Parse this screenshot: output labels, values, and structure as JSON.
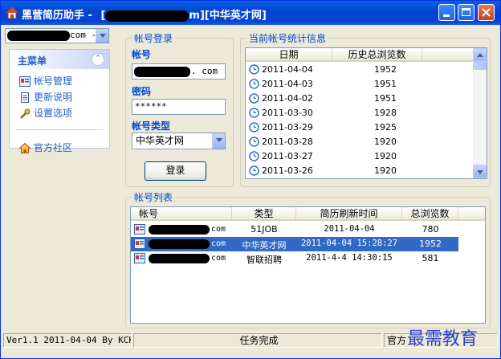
{
  "window": {
    "app_name": "黑营简历助手 -",
    "title_bracket_open": "[",
    "title_mask_suffix": "m]",
    "title_site": "[中华英才网]"
  },
  "left": {
    "account_combo_suffix": "com -",
    "menu_title": "主菜单",
    "collapse_glyph": "⌃",
    "items": [
      "帐号管理",
      "更新说明",
      "设置选项"
    ],
    "community": "官方社区"
  },
  "login": {
    "group_title": "帐号登录",
    "account_label": "帐号",
    "account_value_suffix": ". com",
    "password_label": "密码",
    "password_value": "******",
    "type_label": "帐号类型",
    "type_value": "中华英才网",
    "login_button": "登录"
  },
  "stats": {
    "group_title": "当前帐号统计信息",
    "columns": [
      "日期",
      "历史总浏览数"
    ],
    "rows": [
      {
        "date": "2011-04-04",
        "views": "1952"
      },
      {
        "date": "2011-04-03",
        "views": "1951"
      },
      {
        "date": "2011-04-02",
        "views": "1951"
      },
      {
        "date": "2011-03-30",
        "views": "1928"
      },
      {
        "date": "2011-03-29",
        "views": "1925"
      },
      {
        "date": "2011-03-28",
        "views": "1920"
      },
      {
        "date": "2011-03-27",
        "views": "1920"
      },
      {
        "date": "2011-03-26",
        "views": "1920"
      }
    ]
  },
  "accounts": {
    "group_title": "帐号列表",
    "columns": [
      "帐号",
      "类型",
      "简历刷新时间",
      "总浏览数"
    ],
    "rows": [
      {
        "account_suffix": "com",
        "type": "51JOB",
        "time": "2011-04-04",
        "views": "780"
      },
      {
        "account_suffix": "com",
        "type": "中华英才网",
        "time": "2011-04-04 15:28:27",
        "views": "1952"
      },
      {
        "account_suffix": "com",
        "type": "智联招聘",
        "time": "2011-4-4 14:30:15",
        "views": "581"
      }
    ],
    "selected_row": 1
  },
  "status": {
    "version": "Ver1.1 2011-04-04 By KCK",
    "message": "任务完成",
    "right": "官方"
  },
  "watermark": "最需教育",
  "colors": {
    "title_blue": "#0245CF",
    "label_blue": "#0046D5",
    "selection": "#316AC5",
    "window_bg": "#ECE9D8"
  }
}
